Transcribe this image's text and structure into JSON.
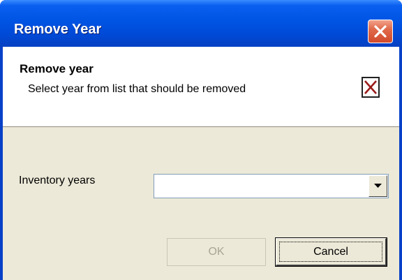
{
  "window": {
    "title": "Remove Year",
    "close_icon": "close-icon"
  },
  "header": {
    "title": "Remove year",
    "subtitle": "Select year from list that should be removed",
    "icon": "delete-icon"
  },
  "form": {
    "inventory_years_label": "Inventory years",
    "inventory_years_value": "",
    "dropdown_icon": "chevron-down-icon"
  },
  "buttons": {
    "ok_label": "OK",
    "cancel_label": "Cancel"
  },
  "colors": {
    "titlebar": "#0054e3",
    "close_button": "#d1492b",
    "client_background": "#ece9d8",
    "header_icon_x": "#9a1a1a"
  }
}
